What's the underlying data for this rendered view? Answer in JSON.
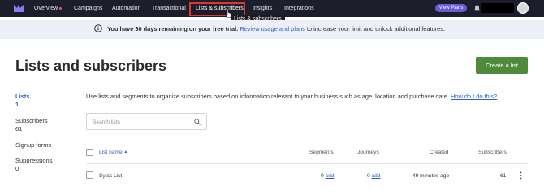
{
  "topnav": {
    "items": [
      {
        "label": "Overview"
      },
      {
        "label": "Campaigns"
      },
      {
        "label": "Automation"
      },
      {
        "label": "Transactional"
      },
      {
        "label": "Lists & subscribers"
      },
      {
        "label": "Insights"
      },
      {
        "label": "Integrations"
      }
    ],
    "active_index": 4,
    "view_plans_label": "View Plans",
    "tooltip": "Lists & subscribers",
    "colors": {
      "background": "#1d1e2c",
      "accent": "#6b5bd9",
      "highlight_box": "#e3342f",
      "notification_dot": "#ff4d6d"
    }
  },
  "banner": {
    "bold_text": "You have 30 days remaining on your free trial.",
    "link_text": "Review usage and plans",
    "tail_text": " to increase your limit and unlock additional features.",
    "icon": "info-icon"
  },
  "header": {
    "title": "Lists and subscribers",
    "create_button": "Create a list",
    "create_button_color": "#4f8a3a"
  },
  "sidebar": {
    "items": [
      {
        "label": "Lists",
        "count": "1"
      },
      {
        "label": "Subscribers",
        "count": "61"
      },
      {
        "label": "Signup forms",
        "count": ""
      },
      {
        "label": "Suppressions",
        "count": "0"
      }
    ],
    "active_index": 0,
    "active_color": "#2b5fc6"
  },
  "main": {
    "intro_text": "Use lists and segments to organize subscribers based on information relevant to your business such as age, location and purchase date.",
    "intro_link": "How do I do this?",
    "search_placeholder": "Search lists"
  },
  "table": {
    "columns": [
      "List name",
      "Segments",
      "Journeys",
      "Created",
      "Subscribers"
    ],
    "sort_indicator": "▲",
    "rows": [
      {
        "name": "Sylas List",
        "segments_count": "0",
        "segments_link": "add",
        "journeys_count": "0",
        "journeys_link": "add",
        "created": "49 minutes ago",
        "subscribers": "61"
      }
    ]
  }
}
